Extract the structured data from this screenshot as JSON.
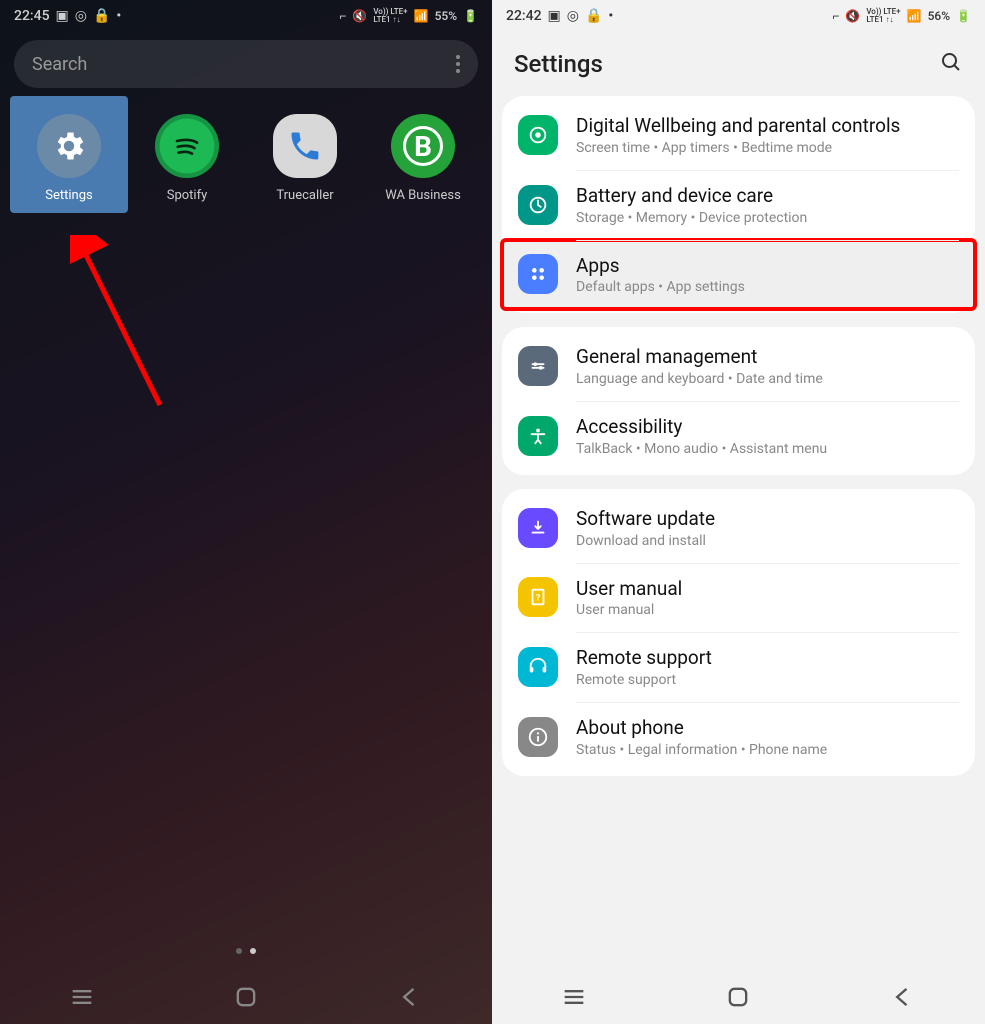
{
  "left": {
    "status": {
      "time": "22:45",
      "battery": "55%",
      "lte": "Vo)) LTE+\nLTE1 ↑↓"
    },
    "search_placeholder": "Search",
    "apps": [
      {
        "label": "Settings"
      },
      {
        "label": "Spotify"
      },
      {
        "label": "Truecaller"
      },
      {
        "label": "WA Business"
      }
    ]
  },
  "right": {
    "status": {
      "time": "22:42",
      "battery": "56%",
      "lte": "Vo)) LTE+\nLTE1 ↑↓"
    },
    "title": "Settings",
    "groups": [
      {
        "items": [
          {
            "icon": "wellbeing",
            "color": "bg-green",
            "title": "Digital Wellbeing and parental controls",
            "sub": "Screen time  •  App timers  •  Bedtime mode"
          },
          {
            "icon": "battery",
            "color": "bg-teal",
            "title": "Battery and device care",
            "sub": "Storage  •  Memory  •  Device protection"
          },
          {
            "icon": "apps",
            "color": "bg-blue",
            "title": "Apps",
            "sub": "Default apps  •  App settings",
            "highlight": true
          }
        ]
      },
      {
        "items": [
          {
            "icon": "general",
            "color": "bg-slate",
            "title": "General management",
            "sub": "Language and keyboard  •  Date and time"
          },
          {
            "icon": "access",
            "color": "bg-agr",
            "title": "Accessibility",
            "sub": "TalkBack  •  Mono audio  •  Assistant menu"
          }
        ]
      },
      {
        "items": [
          {
            "icon": "update",
            "color": "bg-purple",
            "title": "Software update",
            "sub": "Download and install"
          },
          {
            "icon": "manual",
            "color": "bg-yellow",
            "title": "User manual",
            "sub": "User manual"
          },
          {
            "icon": "support",
            "color": "bg-cyan",
            "title": "Remote support",
            "sub": "Remote support"
          },
          {
            "icon": "about",
            "color": "bg-gray",
            "title": "About phone",
            "sub": "Status  •  Legal information  •  Phone name"
          }
        ]
      }
    ]
  }
}
